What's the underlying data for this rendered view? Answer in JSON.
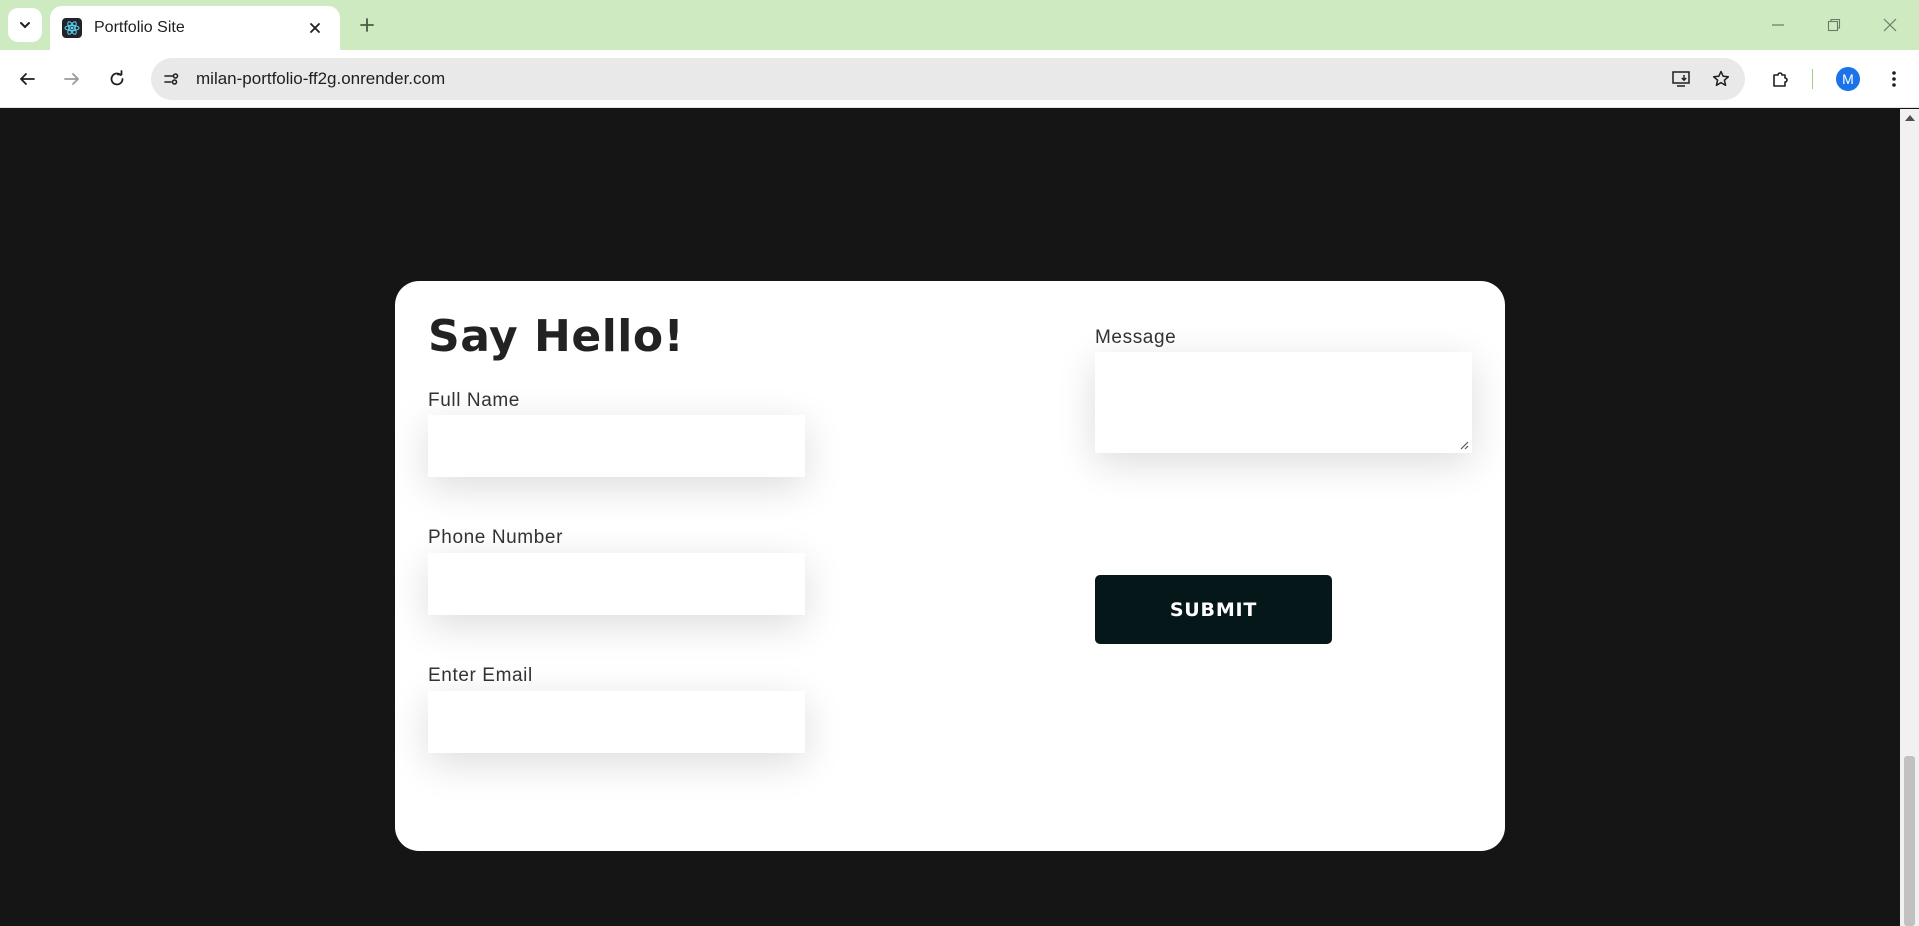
{
  "browser": {
    "tab_title": "Portfolio Site",
    "url": "milan-portfolio-ff2g.onrender.com",
    "profile_initial": "M",
    "icons": [
      "tab-search-icon",
      "react-favicon-icon",
      "close-icon",
      "plus-icon",
      "minimize-icon",
      "restore-icon",
      "window-close-icon",
      "back-arrow-icon",
      "forward-arrow-icon",
      "reload-icon",
      "site-info-icon",
      "install-app-icon",
      "bookmark-star-icon",
      "extensions-puzzle-icon",
      "kebab-menu-icon"
    ]
  },
  "contact_form": {
    "heading": "Say Hello!",
    "full_name_label": "Full Name",
    "phone_label": "Phone Number",
    "email_label": "Enter Email",
    "message_label": "Message",
    "submit_label": "SUBMIT"
  },
  "colors": {
    "page_background": "#151515",
    "card_background": "#ffffff",
    "submit_background": "#06171a",
    "tabstrip_background": "#cdeac0"
  }
}
